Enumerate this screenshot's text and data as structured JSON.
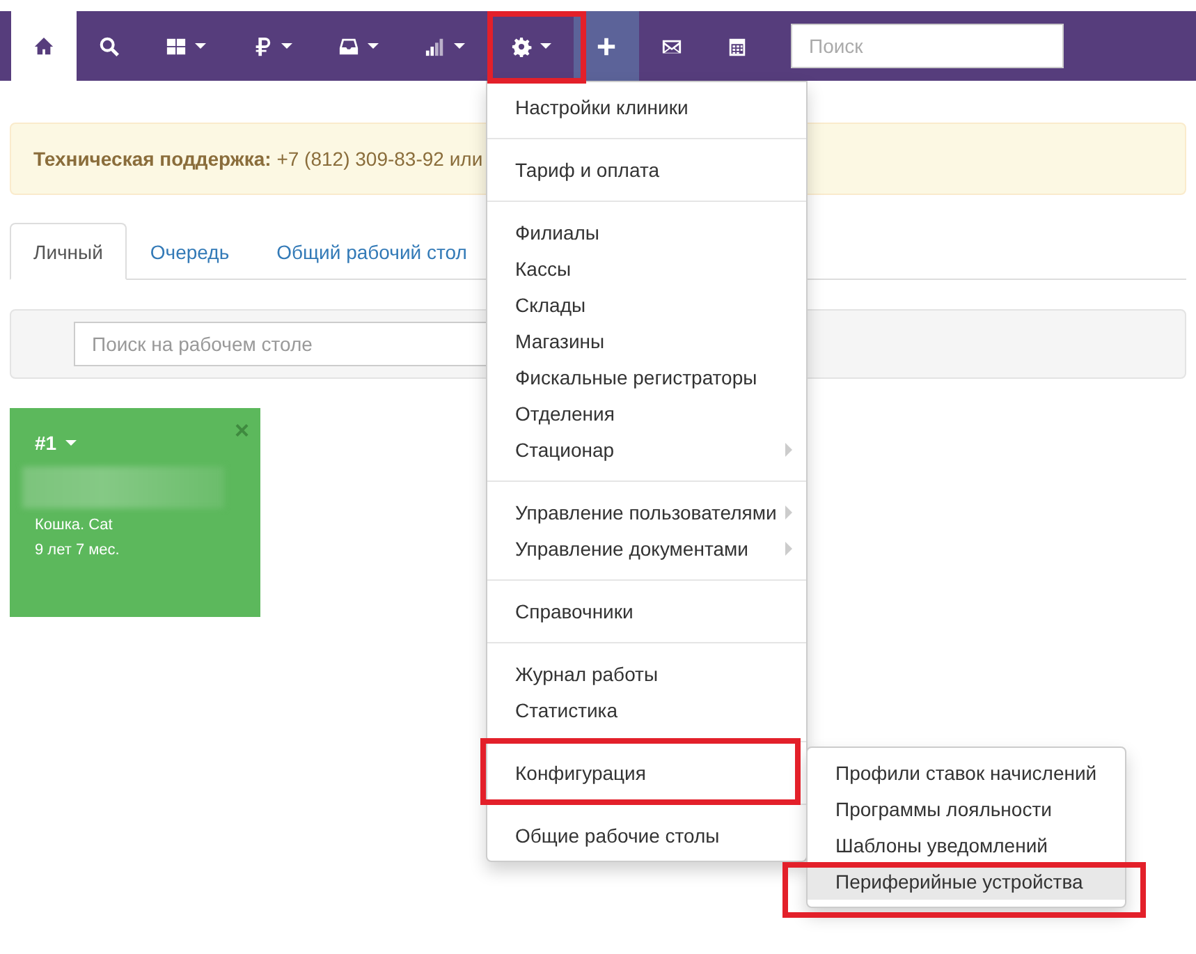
{
  "navbar": {
    "items": [
      {
        "kind": "home",
        "selected": true,
        "caret": false,
        "accent": false,
        "highlighted": false
      },
      {
        "kind": "search",
        "selected": false,
        "caret": false,
        "accent": false,
        "highlighted": false
      },
      {
        "kind": "grid",
        "selected": false,
        "caret": true,
        "accent": false,
        "highlighted": false
      },
      {
        "kind": "ruble",
        "selected": false,
        "caret": true,
        "accent": false,
        "highlighted": false
      },
      {
        "kind": "inbox",
        "selected": false,
        "caret": true,
        "accent": false,
        "highlighted": false
      },
      {
        "kind": "signal",
        "selected": false,
        "caret": true,
        "accent": false,
        "highlighted": false
      },
      {
        "kind": "gear",
        "selected": false,
        "caret": true,
        "accent": false,
        "highlighted": true
      },
      {
        "kind": "plus",
        "selected": false,
        "caret": false,
        "accent": true,
        "highlighted": false
      },
      {
        "kind": "mail",
        "selected": false,
        "caret": false,
        "accent": false,
        "highlighted": false
      },
      {
        "kind": "calendar",
        "selected": false,
        "caret": false,
        "accent": false,
        "highlighted": false
      }
    ],
    "search": {
      "placeholder": "Поиск"
    }
  },
  "alert": {
    "text": "**Техническая поддержка:** +7 (812) 309-83-92 или"
  },
  "tabs": [
    {
      "label": "Личный",
      "selected": true
    },
    {
      "label": "Очередь",
      "selected": false
    },
    {
      "label": "Общий рабочий стол",
      "selected": false
    }
  ],
  "desk_search": {
    "placeholder": "Поиск на рабочем столе"
  },
  "cards": [
    {
      "number": "#1",
      "close": "×",
      "redacted": true,
      "lines": [
        "Кошка. Cat",
        "9 лет 7 мес."
      ],
      "color": "#5cb85c"
    }
  ],
  "menu": {
    "items": [
      {
        "kind": "item",
        "label": "Настройки клиники",
        "submenu": false,
        "highlighted": false
      },
      {
        "kind": "divider"
      },
      {
        "kind": "item",
        "label": "Тариф и оплата",
        "submenu": false,
        "highlighted": false
      },
      {
        "kind": "divider"
      },
      {
        "kind": "item",
        "label": "Филиалы",
        "submenu": false,
        "highlighted": false
      },
      {
        "kind": "item",
        "label": "Кассы",
        "submenu": false,
        "highlighted": false
      },
      {
        "kind": "item",
        "label": "Склады",
        "submenu": false,
        "highlighted": false
      },
      {
        "kind": "item",
        "label": "Магазины",
        "submenu": false,
        "highlighted": false
      },
      {
        "kind": "item",
        "label": "Фискальные регистраторы",
        "submenu": false,
        "highlighted": false
      },
      {
        "kind": "item",
        "label": "Отделения",
        "submenu": false,
        "highlighted": false
      },
      {
        "kind": "item",
        "label": "Стационар",
        "submenu": true,
        "highlighted": false
      },
      {
        "kind": "divider"
      },
      {
        "kind": "item",
        "label": "Управление пользователями",
        "submenu": true,
        "highlighted": false
      },
      {
        "kind": "item",
        "label": "Управление документами",
        "submenu": true,
        "highlighted": false
      },
      {
        "kind": "divider"
      },
      {
        "kind": "item",
        "label": "Справочники",
        "submenu": false,
        "highlighted": false
      },
      {
        "kind": "divider"
      },
      {
        "kind": "item",
        "label": "Журнал работы",
        "submenu": false,
        "highlighted": false
      },
      {
        "kind": "item",
        "label": "Статистика",
        "submenu": false,
        "highlighted": false
      },
      {
        "kind": "divider"
      },
      {
        "kind": "item",
        "label": "Конфигурация",
        "submenu": false,
        "highlighted": true,
        "children": [
          {
            "label": "Профили ставок начислений",
            "selected": false,
            "highlighted": false
          },
          {
            "label": "Программы лояльности",
            "selected": false,
            "highlighted": false
          },
          {
            "label": "Шаблоны уведомлений",
            "selected": false,
            "highlighted": false
          },
          {
            "label": "Периферийные устройства",
            "selected": true,
            "highlighted": true
          }
        ]
      },
      {
        "kind": "divider"
      },
      {
        "kind": "item",
        "label": "Общие рабочие столы",
        "submenu": false,
        "highlighted": false
      }
    ]
  }
}
